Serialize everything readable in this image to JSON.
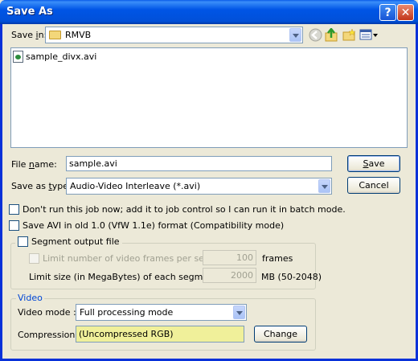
{
  "window": {
    "title": "Save As"
  },
  "save_in": {
    "label_pre": "Save ",
    "label_u": "i",
    "label_post": "n:",
    "value": "RMVB"
  },
  "files": [
    {
      "name": "sample_divx.avi"
    }
  ],
  "file_name": {
    "label_pre": "File ",
    "label_u": "n",
    "label_post": "ame:",
    "value": "sample.avi"
  },
  "save_as_type": {
    "label_pre": "Save as ",
    "label_u": "t",
    "label_post": "ype:",
    "value": "Audio-Video Interleave (*.avi)"
  },
  "buttons": {
    "save_u": "S",
    "save_rest": "ave",
    "cancel": "Cancel",
    "change": "Change"
  },
  "options": {
    "batch": "Don't run this job now; add it to job control so I can run it in batch mode.",
    "old_avi": "Save AVI in old 1.0 (VfW 1.1e) format (Compatibility mode)"
  },
  "segment": {
    "title": "Segment output file",
    "limit_frames_label": "Limit number of video frames per segment to",
    "limit_frames_value": "100",
    "limit_frames_unit": "frames",
    "limit_size_label": "Limit size (in MegaBytes) of each segment to :",
    "limit_size_value": "2000",
    "limit_size_unit": "MB (50-2048)"
  },
  "video": {
    "title": "Video",
    "mode_label": "Video mode :",
    "mode_value": "Full processing mode",
    "compression_label": "Compression :",
    "compression_value": "(Uncompressed RGB)"
  },
  "colors": {
    "title_bar": "#0054e3",
    "compression_highlight": "#f0f09a",
    "video_group_title": "#0046d5"
  }
}
